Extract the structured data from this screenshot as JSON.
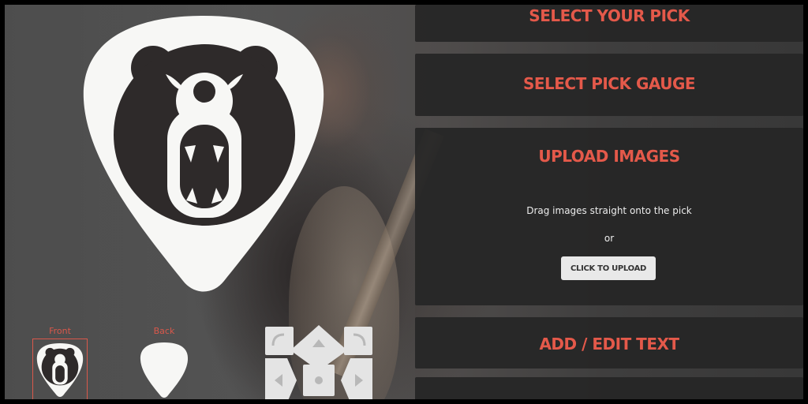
{
  "preview": {
    "front_label": "Front",
    "back_label": "Back"
  },
  "panels": {
    "select_pick": "SELECT YOUR PICK",
    "select_gauge": "SELECT PICK GAUGE",
    "upload_images": "UPLOAD IMAGES",
    "drag_hint": "Drag images straight onto the pick",
    "or_text": "or",
    "upload_button": "CLICK TO UPLOAD",
    "add_text": "ADD / EDIT TEXT"
  },
  "colors": {
    "accent": "#e4594a",
    "panel_bg": "#262626",
    "pick_fill": "#f7f7f5",
    "logo_dark": "#2e2a2a"
  },
  "icons": {
    "pick_logo": "bear-head-icon",
    "dpad": [
      "rotate-left-icon",
      "arrow-up-icon",
      "rotate-right-icon",
      "arrow-left-icon",
      "center-icon",
      "arrow-right-icon",
      "arrow-down-icon"
    ]
  }
}
